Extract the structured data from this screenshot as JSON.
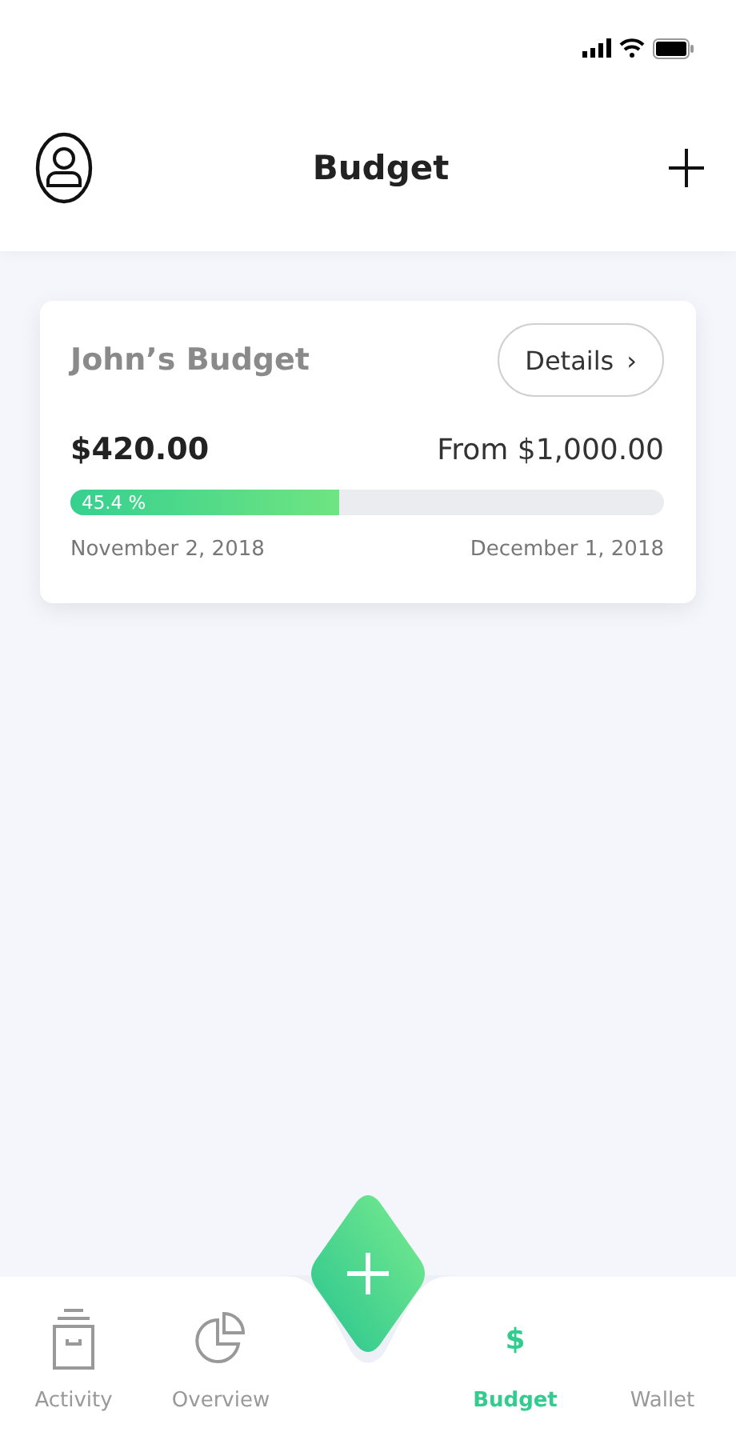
{
  "header": {
    "title": "Budget"
  },
  "budget_card": {
    "name": "John’s Budget",
    "details_button": "Details",
    "chevron": "›",
    "spent": "$420.00",
    "total": "From $1,000.00",
    "level": 0.454,
    "percent": "45.4 %",
    "start_date": "November 2, 2018",
    "end_date": "December 1, 2018"
  },
  "tab_bar": {
    "tabs": [
      {
        "kind": "activity",
        "label": "Activity",
        "selected": false
      },
      {
        "kind": "overview",
        "label": "Overview",
        "selected": false
      },
      {
        "kind": "add"
      },
      {
        "kind": "budget",
        "label": "Budget",
        "icon_text": "$",
        "selected": true
      },
      {
        "kind": "wallet",
        "label": "Wallet",
        "selected": false
      }
    ]
  }
}
